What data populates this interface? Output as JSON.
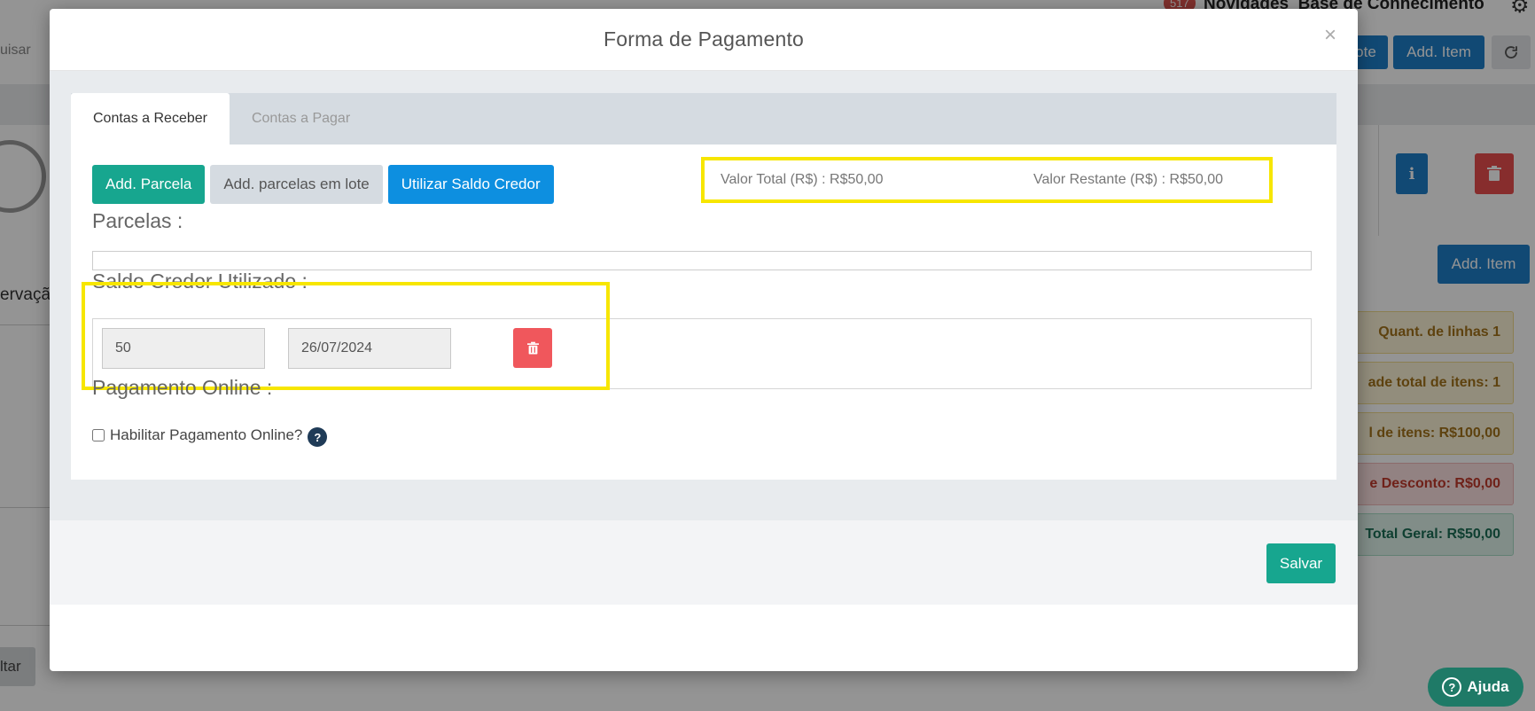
{
  "background": {
    "news_badge": "517",
    "news_label": "Novidades",
    "kb_label": "Base de Conhecimento",
    "search_placeholder_partial": "uisar",
    "btn_lote_partial": "ote",
    "btn_add_item_top": "Add. Item",
    "btn_add_item_mid": "Add. Item",
    "observacao_partial": "ervação",
    "summary": [
      {
        "text": "Quant. de linhas 1",
        "style": "yellow"
      },
      {
        "text": "ade total de itens: 1",
        "style": "yellow"
      },
      {
        "text": "l de itens: R$100,00",
        "style": "yellow"
      },
      {
        "text": "e Desconto: R$0,00",
        "style": "red"
      },
      {
        "text": "Total Geral: R$50,00",
        "style": "green"
      }
    ],
    "voltar_partial": "ltar",
    "ajuda_label": "Ajuda"
  },
  "modal": {
    "title": "Forma de Pagamento",
    "close_glyph": "×",
    "tabs": [
      {
        "label": "Contas a Receber",
        "active": true
      },
      {
        "label": "Contas a Pagar",
        "active": false
      }
    ],
    "buttons": {
      "add_parcela": "Add. Parcela",
      "add_lote": "Add. parcelas em lote",
      "saldo_credor": "Utilizar Saldo Credor"
    },
    "valor_total": "Valor Total (R$) : R$50,00",
    "valor_restante": "Valor Restante (R$) : R$50,00",
    "parcelas_label": "Parcelas :",
    "saldo_label": "Saldo Credor Utilizado :",
    "saldo_entry": {
      "value": "50",
      "date": "26/07/2024"
    },
    "online_label": "Pagamento Online :",
    "online_checkbox_label": "Habilitar Pagamento Online?",
    "online_help_glyph": "?",
    "save_label": "Salvar"
  },
  "colors": {
    "accent_teal": "#17a68f",
    "accent_blue": "#0d8fe0",
    "danger": "#f0575c",
    "highlight": "#f7e600"
  }
}
